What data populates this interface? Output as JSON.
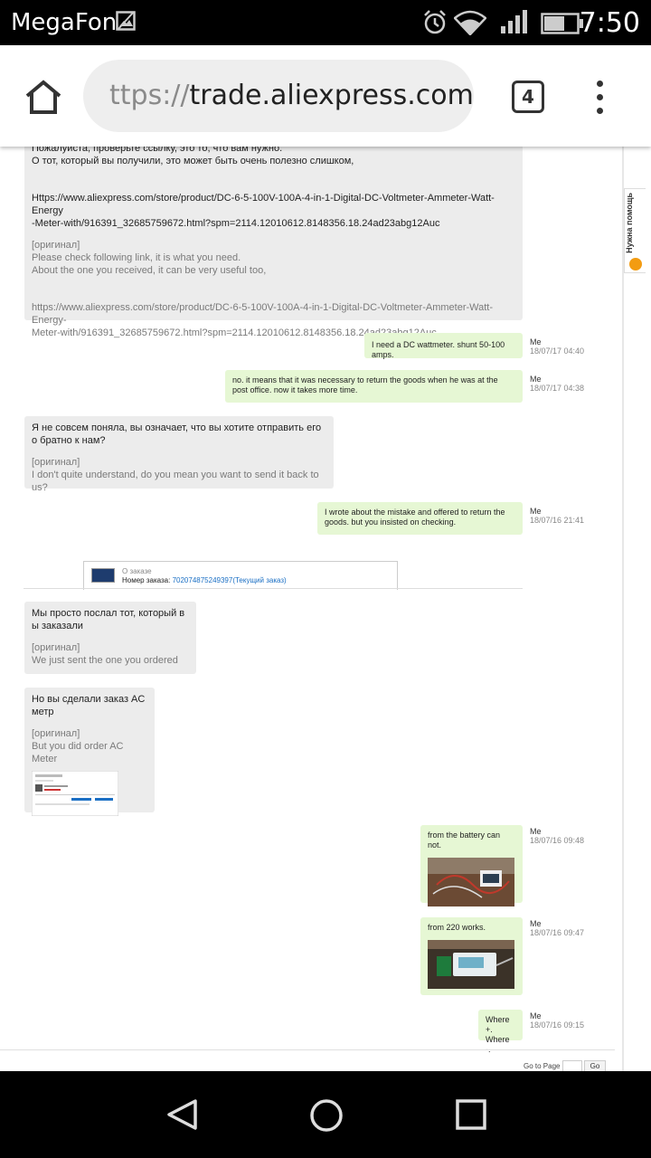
{
  "status_bar": {
    "carrier": "MegaFon",
    "time": "7:50",
    "icons": [
      "image-icon",
      "alarm-icon",
      "wifi-icon",
      "signal-icon",
      "battery-icon"
    ]
  },
  "browser": {
    "url_scheme": "ttps://",
    "url_host": "trade.aliexpress.com",
    "tab_count": "4"
  },
  "help_tab": {
    "label": "Нужна помощь"
  },
  "messages": [
    {
      "from": "seller",
      "text_lines": [
        "Пожалуиста, проверьте ссылку, это то, что вам нужно.",
        "О тот, который вы получили, это может быть очень полезно слишком,",
        "",
        "",
        "Https://www.aliexpress.com/store/product/DC-6-5-100V-100A-4-in-1-Digital-DC-Voltmeter-Ammeter-Watt-Energy",
        "-Meter-with/916391_32685759672.html?spm=2114.12010612.8148356.18.24ad23abg12Auc"
      ],
      "original_label": "[оригинал]",
      "original_lines": [
        "Please check following link, it is what you need.",
        "About the one you received, it can be very useful too,",
        "",
        "",
        "https://www.aliexpress.com/store/product/DC-6-5-100V-100A-4-in-1-Digital-DC-Voltmeter-Ammeter-Watt-Energy-",
        "Meter-with/916391_32685759672.html?spm=2114.12010612.8148356.18.24ad23abg12Auc"
      ]
    },
    {
      "from": "me",
      "text": "I need a DC wattmeter. shunt 50-100 amps.",
      "who": "Me",
      "when": "18/07/17 04:40"
    },
    {
      "from": "me",
      "text": "no. it means that it was necessary to return the goods when he was at the post office. now it takes more time.",
      "who": "Me",
      "when": "18/07/17 04:38"
    },
    {
      "from": "seller",
      "text": "Я не совсем поняла, вы означает, что вы хотите отправить его о братно к нам?",
      "original_label": "[оригинал]",
      "original": "I don't quite understand, do you mean you want to send it back to us?"
    },
    {
      "from": "me",
      "text": "I wrote about the mistake and offered to return the goods. but you insisted on checking.",
      "who": "Me",
      "when": "18/07/16 21:41"
    },
    {
      "from": "seller",
      "text": "Мы просто послал тот, который в ы заказали",
      "original_label": "[оригинал]",
      "original": "We just sent the one you ordered"
    },
    {
      "from": "seller",
      "text": "Но вы сделали заказ AC метр",
      "original_label": "[оригинал]",
      "original": "But you did order AC Meter"
    },
    {
      "from": "me",
      "text": "from the battery can not.",
      "who": "Me",
      "when": "18/07/16 09:48"
    },
    {
      "from": "me",
      "text": "from 220 works.",
      "who": "Me",
      "when": "18/07/16 09:47"
    },
    {
      "from": "me",
      "text_lines": [
        "Where +.",
        "Where -."
      ],
      "who": "Me",
      "when": "18/07/16 09:15"
    }
  ],
  "order_card": {
    "title": "О заказе",
    "order_label": "Номер заказа:",
    "order_number": "702074875249397(Текущий заказ)"
  },
  "pager": {
    "goto_label": "Go to Page",
    "go_button": "Go"
  },
  "colors": {
    "received_bg": "#ececec",
    "sent_bg": "#e6f7d4",
    "link": "#1a6fc4"
  }
}
